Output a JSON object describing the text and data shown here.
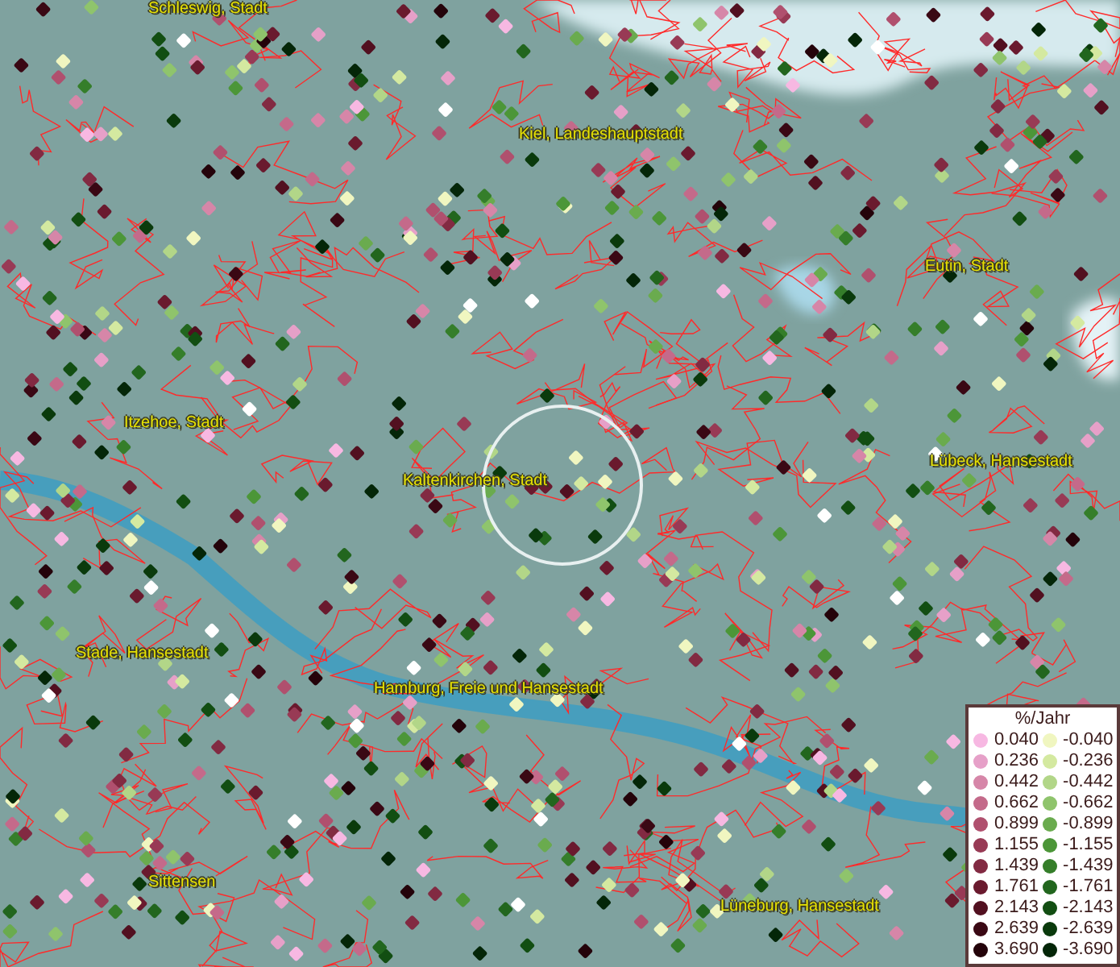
{
  "map": {
    "place_labels": [
      "Schleswig, Stadt",
      "Kiel, Landeshauptstadt",
      "Eutin, Stadt",
      "Itzehoe, Stadt",
      "Kaltenkirchen, Stadt",
      "Lübeck, Hansestadt",
      "Stade, Hansestadt",
      "Hamburg, Freie und Hansestadt",
      "Sittensen",
      "Lüneburg, Hansestadt"
    ]
  },
  "legend": {
    "title": "%/Jahr",
    "positive": [
      {
        "label": "0.040",
        "color": "#f7b8e2"
      },
      {
        "label": "0.236",
        "color": "#e6a0c8"
      },
      {
        "label": "0.442",
        "color": "#d686a8"
      },
      {
        "label": "0.662",
        "color": "#c46a8a"
      },
      {
        "label": "0.899",
        "color": "#b0506e"
      },
      {
        "label": "1.155",
        "color": "#983a55"
      },
      {
        "label": "1.439",
        "color": "#822a42"
      },
      {
        "label": "1.761",
        "color": "#6a1a2e"
      },
      {
        "label": "2.143",
        "color": "#521020"
      },
      {
        "label": "2.639",
        "color": "#3a0814"
      },
      {
        "label": "3.690",
        "color": "#24030a"
      }
    ],
    "negative": [
      {
        "label": "-0.040",
        "color": "#f0f6c0"
      },
      {
        "label": "-0.236",
        "color": "#d4e9a0"
      },
      {
        "label": "-0.442",
        "color": "#b2d688"
      },
      {
        "label": "-0.662",
        "color": "#8fc46c"
      },
      {
        "label": "-0.899",
        "color": "#6aab4e"
      },
      {
        "label": "-1.155",
        "color": "#4c9638"
      },
      {
        "label": "-1.439",
        "color": "#357e2a"
      },
      {
        "label": "-1.761",
        "color": "#22661e"
      },
      {
        "label": "-2.143",
        "color": "#124e12"
      },
      {
        "label": "-2.639",
        "color": "#0a3a0c"
      },
      {
        "label": "-3.690",
        "color": "#042608"
      }
    ]
  }
}
